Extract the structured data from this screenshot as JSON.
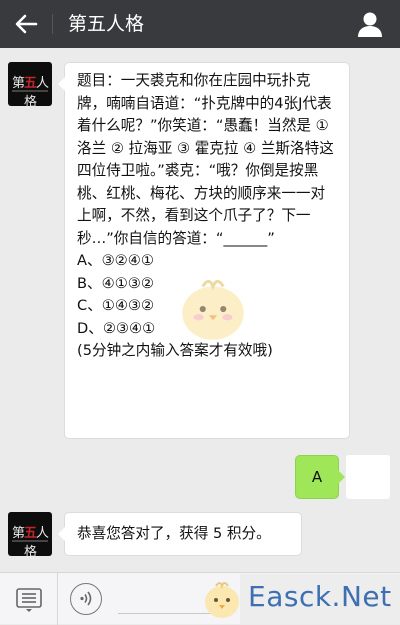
{
  "header": {
    "title": "第五人格"
  },
  "messages": {
    "question": {
      "sender_logo_prefix": "第",
      "sender_logo_highlight": "五",
      "sender_logo_suffix": "人格",
      "text": "题目：一天裘克和你在庄园中玩扑克牌，喃喃自语道：“扑克牌中的4张J代表着什么呢？”你笑道：“愚蠢！当然是 ① 洛兰 ② 拉海亚 ③ 霍克拉 ④ 兰斯洛特这四位侍卫啦。”裘克：“哦？你倒是按黑桃、红桃、梅花、方块的顺序来一一对上啊，不然，看到这个爪子了？下一秒…”你自信的答道：“______”",
      "options": [
        "A、③②④①",
        "B、④①③②",
        "C、①④③②",
        "D、②③④①"
      ],
      "note": "(5分钟之内输入答案才有效哦)"
    },
    "sent": {
      "text": "A"
    },
    "reply": {
      "text": "恭喜您答对了，获得 5 积分。"
    }
  },
  "watermark": {
    "text": "Easck.Net"
  },
  "colors": {
    "topbar": "#393a3e",
    "background": "#ebebeb",
    "sent_bubble": "#9fe658",
    "logo_red": "#c0262a",
    "watermark": "#3d6fb2"
  },
  "icons": {
    "back": "arrow-left-icon",
    "profile": "person-icon",
    "menu": "keyboard-menu-icon",
    "voice": "voice-icon"
  }
}
